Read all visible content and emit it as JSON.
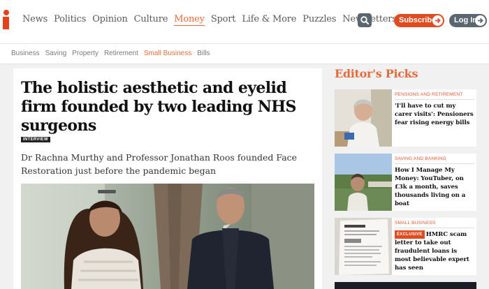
{
  "brand": {
    "logo": "i",
    "accent": "#e6411b",
    "active_color": "#e66a3a"
  },
  "nav": {
    "items": [
      "News",
      "Politics",
      "Opinion",
      "Culture",
      "Money",
      "Sport",
      "Life & More",
      "Puzzles",
      "Newsletters"
    ],
    "active": "Money",
    "search_icon": "search-icon",
    "subscribe_label": "Subscribe",
    "login_label": "Log In"
  },
  "subnav": {
    "items": [
      "Business",
      "Saving",
      "Property",
      "Retirement",
      "Small Business",
      "Bills"
    ],
    "active": "Small Business"
  },
  "article": {
    "headline": "The holistic aesthetic and eyelid firm founded by two leading NHS surgeons",
    "tag": "INTERVIEW",
    "standfirst": "Dr Rachna Murthy and Professor Jonathan Roos founded Face Restoration just before the pandemic began"
  },
  "editors_picks": {
    "title": "Editor's Picks",
    "items": [
      {
        "category": "Pensions and retirement",
        "title": "'I'll have to cut my carer visits': Pensioners fear rising energy bills",
        "exclusive": ""
      },
      {
        "category": "Saving and banking",
        "title": "How I Manage My Money: YouTuber, on £3k a month, saves thousands living on a boat",
        "exclusive": ""
      },
      {
        "category": "Small business",
        "title": "HMRC scam letter to take out fraudulent loans is most believable expert has seen",
        "exclusive": "EXCLUSIVE"
      }
    ]
  }
}
